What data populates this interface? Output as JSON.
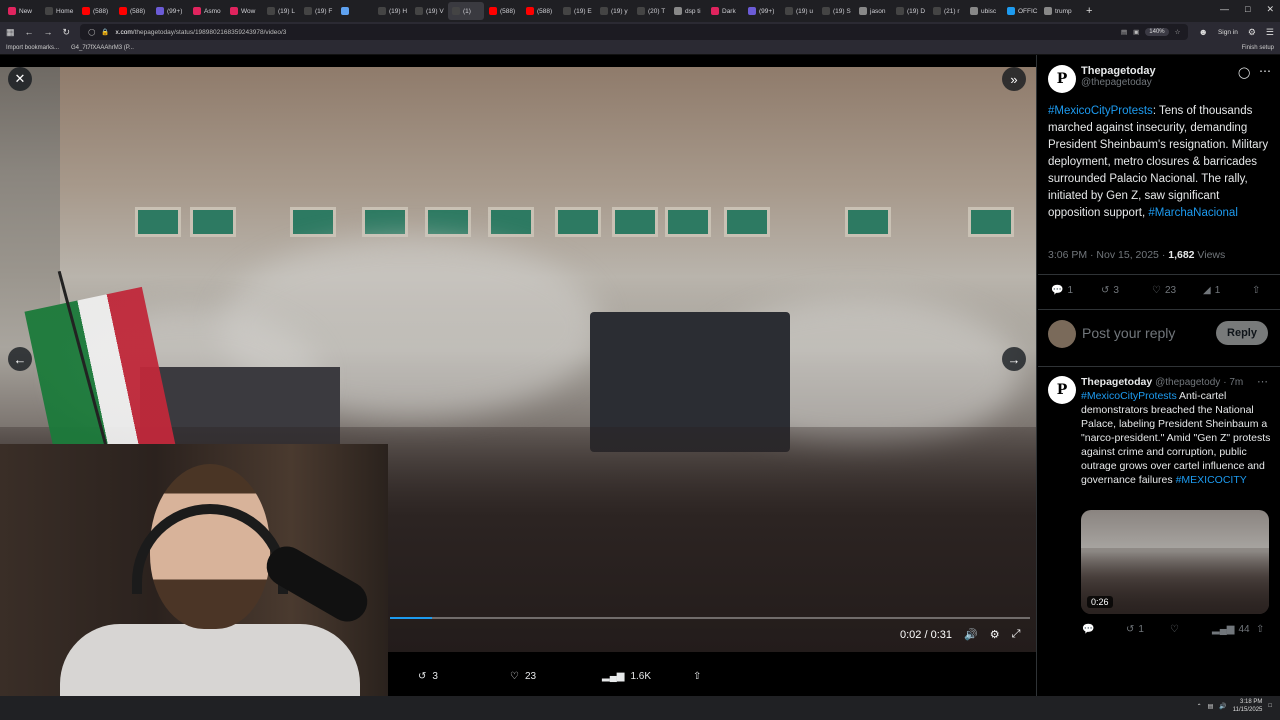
{
  "browser": {
    "tabs": [
      {
        "label": "New",
        "color": "#e0245e"
      },
      {
        "label": "Home",
        "color": "#444"
      },
      {
        "label": "(588)",
        "color": "#ff0000"
      },
      {
        "label": "(588)",
        "color": "#ff0000"
      },
      {
        "label": "(99+)",
        "color": "#6b5bd6"
      },
      {
        "label": "Asmo",
        "color": "#e0245e"
      },
      {
        "label": "Wow",
        "color": "#e0245e"
      },
      {
        "label": "(19) L",
        "color": "#444"
      },
      {
        "label": "(19) F",
        "color": "#444"
      },
      {
        "label": "",
        "color": "#5ea1f0"
      },
      {
        "label": "(19) H",
        "color": "#444"
      },
      {
        "label": "(19) V",
        "color": "#444"
      },
      {
        "label": "(1)",
        "color": "#444",
        "active": true
      },
      {
        "label": "(588)",
        "color": "#ff0000"
      },
      {
        "label": "(588)",
        "color": "#ff0000"
      },
      {
        "label": "(19) E",
        "color": "#444"
      },
      {
        "label": "(19) y",
        "color": "#444"
      },
      {
        "label": "(20) T",
        "color": "#444"
      },
      {
        "label": "dsp ti",
        "color": "#888"
      },
      {
        "label": "Dark",
        "color": "#e0245e"
      },
      {
        "label": "(99+)",
        "color": "#6b5bd6"
      },
      {
        "label": "(19) u",
        "color": "#444"
      },
      {
        "label": "(19) S",
        "color": "#444"
      },
      {
        "label": "jason",
        "color": "#888"
      },
      {
        "label": "(19) D",
        "color": "#444"
      },
      {
        "label": "(21) r",
        "color": "#444"
      },
      {
        "label": "ubisc",
        "color": "#888"
      },
      {
        "label": "OFFIC",
        "color": "#1d9bf0"
      },
      {
        "label": "trump",
        "color": "#888"
      }
    ],
    "url_host": "x.com",
    "url_path": "/thepagetoday/status/1989802168359243978/video/3",
    "zoom": "140%",
    "sign_in": "Sign in",
    "bookmarks": [
      "Import bookmarks...",
      "G4_7t7fXAAAhrM3 (P..."
    ],
    "finish_setup": "Finish setup",
    "add_tab": "+"
  },
  "video": {
    "time": "0:02 / 0:31",
    "progress_fraction": 0.065
  },
  "actions": {
    "reposts": "3",
    "likes": "23",
    "views": "1.6K"
  },
  "tweet": {
    "author_name": "Thepagetoday",
    "author_handle": "@thepagetoday",
    "avatar_letter": "P",
    "hashtag1": "#MexicoCityProtests",
    "body": ": Tens of thousands marched against insecurity, demanding President Sheinbaum's resignation. Military deployment, metro closures & barricades surrounded Palacio Nacional. The rally, initiated by Gen Z, saw significant opposition support,",
    "hashtag2": "#MarchaNacional",
    "timestamp": "3:06 PM · Nov 15, 2025 · ",
    "views_count": "1,682",
    "views_label": " Views",
    "stats": {
      "replies": "1",
      "reposts": "3",
      "likes": "23",
      "bookmarks": "1"
    }
  },
  "reply_box": {
    "placeholder": "Post your reply",
    "button": "Reply"
  },
  "reply": {
    "author_name": "Thepagetoday",
    "author_handle": "@thepagetody",
    "age": "· 7m",
    "hashtag1": "#MexicoCityProtests",
    "body": " Anti-cartel demonstrators breached the National Palace, labeling President Sheinbaum a \"narco-president.\" Amid \"Gen Z\" protests against crime and corruption, public outrage grows over cartel influence and governance failures",
    "hashtag2": "#MEXICOCITY",
    "thumb_duration": "0:26",
    "stats": {
      "replies": "",
      "reposts": "1",
      "likes": "",
      "views": "44"
    }
  },
  "taskbar": {
    "time": "3:18 PM",
    "date": "11/15/2025"
  }
}
